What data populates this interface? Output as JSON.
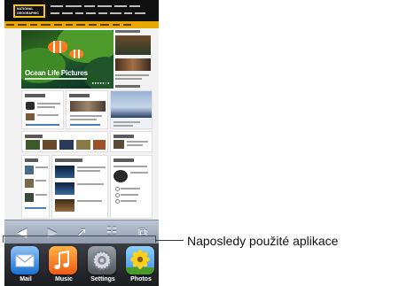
{
  "page": {
    "logo_text": "NATIONAL GEOGRAPHIC",
    "hero_title": "Ocean Life Pictures",
    "hero_dots": "●●●●●○●",
    "brand_colors": {
      "header": "#101010",
      "menubar": "#e8a800",
      "logo_border": "#f4c21a"
    }
  },
  "toolbar": {
    "back_icon": "◀",
    "forward_icon": "▶",
    "share_icon": "↗",
    "bookmarks_icon": "☷",
    "pages_icon": "⧉"
  },
  "dock": {
    "apps": [
      {
        "label": "Mail",
        "icon": "mail-icon"
      },
      {
        "label": "Music",
        "icon": "music-icon"
      },
      {
        "label": "Settings",
        "icon": "settings-icon"
      },
      {
        "label": "Photos",
        "icon": "photos-icon"
      }
    ]
  },
  "callout": {
    "text": "Naposledy použité aplikace"
  }
}
